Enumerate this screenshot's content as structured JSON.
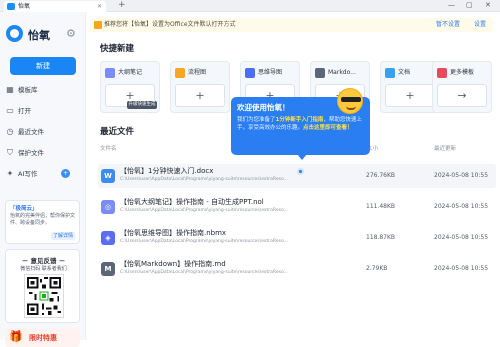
{
  "window": {
    "tab_title": "怡氧",
    "new_tab": "+",
    "min": "—",
    "max": "▢",
    "close": "✕"
  },
  "brand": {
    "name": "怡氧"
  },
  "sidebar": {
    "new_button": "新建",
    "items": [
      {
        "icon": "template-icon",
        "glyph": "▦",
        "label": "模板库"
      },
      {
        "icon": "open-folder-icon",
        "glyph": "▭",
        "label": "打开"
      },
      {
        "icon": "recent-clock-icon",
        "glyph": "◷",
        "label": "最近文件"
      },
      {
        "icon": "shield-icon",
        "glyph": "⛉",
        "label": "保护文件"
      },
      {
        "icon": "ai-sparkle-icon",
        "glyph": "✦",
        "label": "AI写作"
      }
    ],
    "promo": {
      "title": "「极简云」",
      "desc": "怡氧的完美伴侣，帮你保护文件、跨设备同步。",
      "link": "了解详情"
    },
    "feedback": {
      "title": "－ 意见反馈 －",
      "subtitle": "微信扫码 联系者我们"
    },
    "limited": {
      "label": "限时特惠"
    }
  },
  "notice": {
    "text": "推荐您将【怡氧】设置为Office文件默认打开方式",
    "set": "暂不设置",
    "later": "设置"
  },
  "quick_new": {
    "heading": "快捷新建",
    "cards": [
      {
        "label": "大纲笔记",
        "color": "#7b8cf5",
        "icon": "outline-note-icon",
        "badge": "升级快速生成PPT"
      },
      {
        "label": "流程图",
        "color": "#f5a623",
        "icon": "flowchart-icon",
        "badge": ""
      },
      {
        "label": "思维导图",
        "color": "#4b6ef5",
        "icon": "mindmap-icon",
        "badge": ""
      },
      {
        "label": "Markdo...",
        "color": "#5b6678",
        "icon": "markdown-icon",
        "badge": ""
      },
      {
        "label": "文档",
        "color": "#3aa0f2",
        "icon": "document-icon",
        "badge": ""
      },
      {
        "label": "更多模板",
        "color": "#e8495b",
        "icon": "more-templates-icon",
        "badge": ""
      }
    ]
  },
  "recent": {
    "heading": "最近文件",
    "col_name": "文件名",
    "col_size": "大小",
    "col_date": "最近更新",
    "rows": [
      {
        "icon": "word-file-icon",
        "glyph": "W",
        "color": "#3b8cf0",
        "name": "【怡氧】1分钟快速入门.docx",
        "path": "C:\\Users\\user\\AppData\\Local\\Programs\\yiyang-suite\\resources\\extraReso...",
        "size": "276.76KB",
        "date": "2024-05-08 10:55"
      },
      {
        "icon": "outline-file-icon",
        "glyph": "◎",
        "color": "#7b8cf5",
        "name": "【怡氧大纲笔记】操作指南 - 自动生成PPT.nol",
        "path": "C:\\Users\\user\\AppData\\Local\\Programs\\yiyang-suite\\resources\\extraReso...",
        "size": "111.48KB",
        "date": "2024-05-08 10:55"
      },
      {
        "icon": "mindmap-file-icon",
        "glyph": "◈",
        "color": "#5b6ef0",
        "name": "【怡氧思维导图】操作指南.nbmx",
        "path": "C:\\Users\\user\\AppData\\Local\\Programs\\yiyang-suite\\resources\\extraReso...",
        "size": "118.87KB",
        "date": "2024-05-08 10:55"
      },
      {
        "icon": "markdown-file-icon",
        "glyph": "M",
        "color": "#5b6678",
        "name": "【怡氧Markdown】操作指南.md",
        "path": "C:\\Users\\user\\AppData\\Local\\Programs\\yiyang-suite\\resources\\extraReso...",
        "size": "2.79KB",
        "date": "2024-05-08 10:55"
      }
    ]
  },
  "welcome": {
    "title": "欢迎使用怡氧！",
    "body_a": "我们为您准备了",
    "body_b": "1分钟新手入门指南",
    "body_c": "，帮助您快速上手，享受高效办公的乐趣。",
    "body_d": "点击这里即可查看！"
  }
}
